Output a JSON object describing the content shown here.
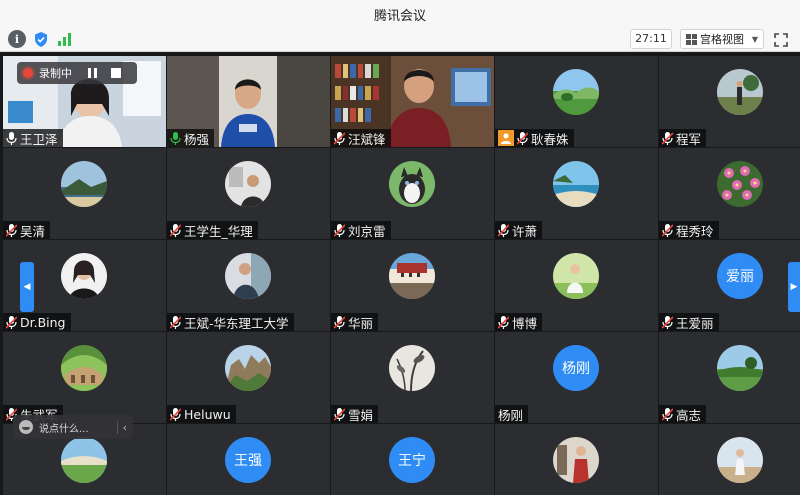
{
  "window": {
    "title": "腾讯会议"
  },
  "toolbar": {
    "timer": "27:11",
    "view_label": "宫格视图",
    "icons": [
      "info-icon",
      "shield-icon",
      "signal-icon",
      "grid-view-icon",
      "chevron-down-icon",
      "fullscreen-icon"
    ]
  },
  "recording": {
    "label": "录制中"
  },
  "chat": {
    "placeholder": "说点什么..."
  },
  "colors": {
    "accent": "#2f8cf5",
    "active_speaker": "#2fbe4c",
    "recording": "#e8463b",
    "host_badge": "#f29a29"
  },
  "participants": [
    {
      "name": "王卫泽",
      "avatar_text": ""
    },
    {
      "name": "杨强",
      "avatar_text": ""
    },
    {
      "name": "汪斌锋",
      "avatar_text": ""
    },
    {
      "name": "耿春姝",
      "avatar_text": ""
    },
    {
      "name": "程军",
      "avatar_text": ""
    },
    {
      "name": "吴清",
      "avatar_text": ""
    },
    {
      "name": "王学生_华理",
      "avatar_text": ""
    },
    {
      "name": "刘京雷",
      "avatar_text": ""
    },
    {
      "name": "许萧",
      "avatar_text": ""
    },
    {
      "name": "程秀玲",
      "avatar_text": ""
    },
    {
      "name": "Dr.Bing",
      "avatar_text": ""
    },
    {
      "name": "王斌-华东理工大学",
      "avatar_text": ""
    },
    {
      "name": "华丽",
      "avatar_text": ""
    },
    {
      "name": "博博",
      "avatar_text": ""
    },
    {
      "name": "王爱丽",
      "avatar_text": "爱丽"
    },
    {
      "name": "朱武军",
      "avatar_text": ""
    },
    {
      "name": "Heluwu",
      "avatar_text": ""
    },
    {
      "name": "雪娟",
      "avatar_text": ""
    },
    {
      "name": "杨刚",
      "avatar_text": "杨刚"
    },
    {
      "name": "高志",
      "avatar_text": ""
    },
    {
      "name": "",
      "avatar_text": ""
    },
    {
      "name": "",
      "avatar_text": "王强"
    },
    {
      "name": "",
      "avatar_text": "王宁"
    },
    {
      "name": "",
      "avatar_text": ""
    },
    {
      "name": "",
      "avatar_text": ""
    }
  ]
}
